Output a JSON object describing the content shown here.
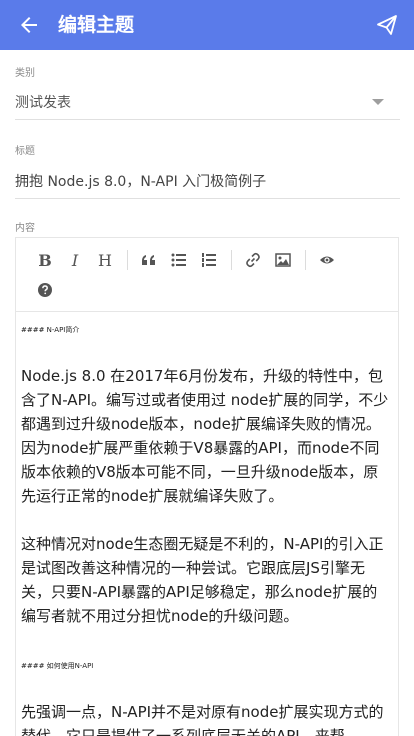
{
  "appbar": {
    "back_icon": "arrow-left-icon",
    "title": "编辑主题",
    "send_icon": "send-icon",
    "color": "#5a7bea"
  },
  "category": {
    "label": "类别",
    "value": "测试发表"
  },
  "title_field": {
    "label": "标题",
    "value": "拥抱 Node.js 8.0，N-API 入门极简例子"
  },
  "content": {
    "label": "内容",
    "toolbar": {
      "bold": "B",
      "italic": "I",
      "heading": "H"
    },
    "heading1": "#### N-API简介",
    "para1": "Node.js 8.0 在2017年6月份发布，升级的特性中，包含了N-API。编写过或者使用过 node扩展的同学，不少都遇到过升级node版本，node扩展编译失败的情况。因为node扩展严重依赖于V8暴露的API，而node不同版本依赖的V8版本可能不同，一旦升级node版本，原先运行正常的node扩展就编译失败了。",
    "para2": "这种情况对node生态圈无疑是不利的，N-API的引入正是试图改善这种情况的一种尝试。它跟底层JS引擎无关，只要N-API暴露的API足够稳定，那么node扩展的编写者就不用过分担忧node的升级问题。",
    "heading2": "#### 如何使用N-API",
    "para3": "先强调一点，N-API并不是对原有node扩展实现方式的替代，它只是提供了一系列底层无关的API，来帮"
  }
}
